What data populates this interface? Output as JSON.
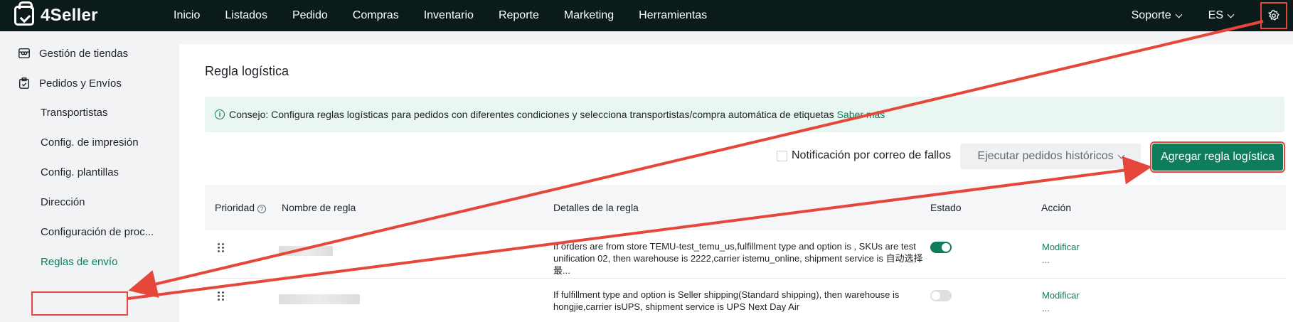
{
  "app": {
    "brand": "4Seller"
  },
  "nav": {
    "items": [
      "Inicio",
      "Listados",
      "Pedido",
      "Compras",
      "Inventario",
      "Reporte",
      "Marketing",
      "Herramientas"
    ],
    "support": "Soporte",
    "language": "ES",
    "settings_icon": "gear-icon"
  },
  "sidebar": {
    "groups": [
      {
        "label": "Gestión de tiendas",
        "icon": "store-icon"
      },
      {
        "label": "Pedidos y Envíos",
        "icon": "clipboard-icon"
      }
    ],
    "subitems": [
      "Transportistas",
      "Config. de impresión",
      "Config. plantillas",
      "Dirección",
      "Configuración de proc...",
      "Reglas de envío"
    ]
  },
  "page": {
    "title": "Regla logística",
    "tip": "Consejo: Configura reglas logísticas para pedidos con diferentes condiciones y selecciona transportistas/compra automática de etiquetas",
    "tip_link": "Saber más",
    "notify_label": "Notificación por correo de fallos",
    "run_historic": "Ejecutar pedidos históricos",
    "add_rule": "Agregar regla logística"
  },
  "table": {
    "headers": {
      "priority": "Prioridad",
      "name": "Nombre de regla",
      "details": "Detalles de la regla",
      "status": "Estado",
      "action": "Acción"
    },
    "rows": [
      {
        "details": "If orders are from store TEMU-test_temu_us,fulfillment type and option is , SKUs are test unification 02, then warehouse is 2222,carrier istemu_online, shipment service is 自动选择最...",
        "enabled": true,
        "action": "Modificar",
        "more": "..."
      },
      {
        "details": "If fulfillment type and option is Seller shipping(Standard shipping), then warehouse is hongjie,carrier isUPS, shipment service is UPS Next Day Air",
        "enabled": false,
        "action": "Modificar",
        "more": "..."
      }
    ]
  },
  "colors": {
    "brand": "#0d7d5c",
    "topbar": "#0b1b1a",
    "annotation": "#e5473b"
  }
}
